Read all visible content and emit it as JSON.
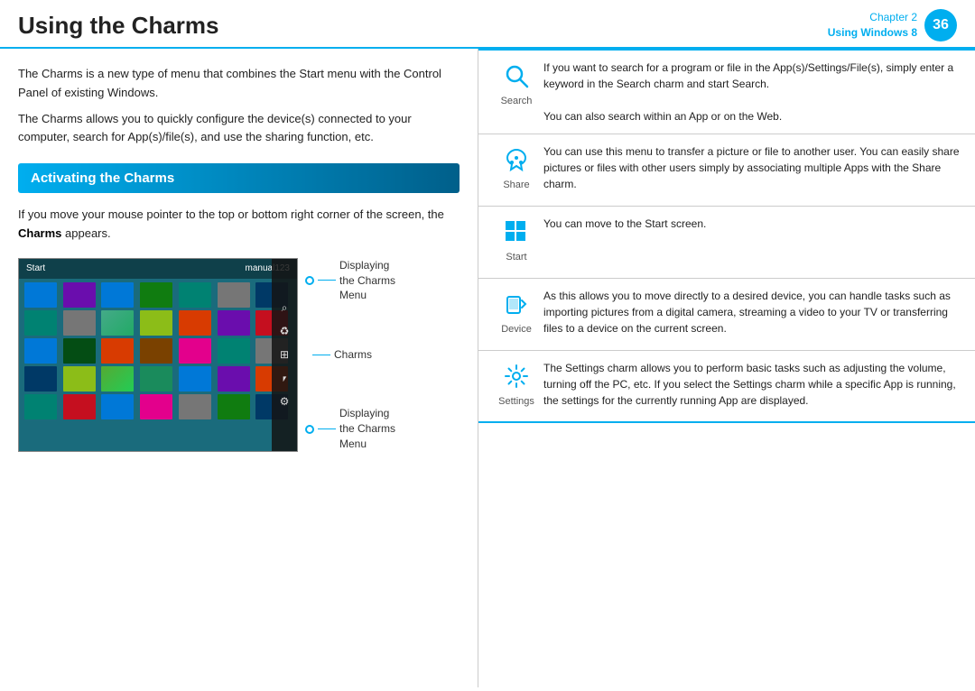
{
  "header": {
    "title": "Using the Charms",
    "chapter_label": "Chapter 2",
    "chapter_subtitle": "Using Windows 8",
    "chapter_number": "36"
  },
  "intro": {
    "paragraph1": "The Charms is a new type of menu that combines the Start menu with the Control Panel of existing Windows.",
    "paragraph2": "The Charms allows you to quickly configure the device(s) connected to your computer, search for App(s)/file(s), and use the sharing function, etc."
  },
  "activating": {
    "section_title": "Activating the Charms",
    "description": "If you move your mouse pointer to the top or bottom right corner of the screen, the Charms appears.",
    "description_bold": "Charms"
  },
  "screenshot": {
    "start_label": "Start",
    "user_label": "manual123",
    "callout1_text": "Displaying\nthe Charms\nMenu",
    "callout2_text": "Charms",
    "callout3_text": "Displaying\nthe Charms\nMenu"
  },
  "charms": [
    {
      "name": "Search",
      "icon": "search",
      "description": "If you want to search for a program or file in the App(s)/Settings/File(s), simply enter a keyword in the Search charm and start Search.\n\nYou can also search within an App or on the Web."
    },
    {
      "name": "Share",
      "icon": "share",
      "description": "You can use this menu to transfer a picture or file to another user. You can easily share pictures or files with other users simply by associating multiple Apps with the Share charm."
    },
    {
      "name": "Start",
      "icon": "start",
      "description": "You can move to the Start screen."
    },
    {
      "name": "Device",
      "icon": "device",
      "description": "As this allows you to move directly to a desired device, you can handle tasks such as importing pictures from a digital camera, streaming a video to your TV or transferring files to a device on the current screen."
    },
    {
      "name": "Settings",
      "icon": "settings",
      "description": "The Settings charm allows you to perform basic tasks such as adjusting the volume, turning off the PC, etc. If you select the Settings charm while a specific App is running, the settings for the currently running App are displayed."
    }
  ]
}
